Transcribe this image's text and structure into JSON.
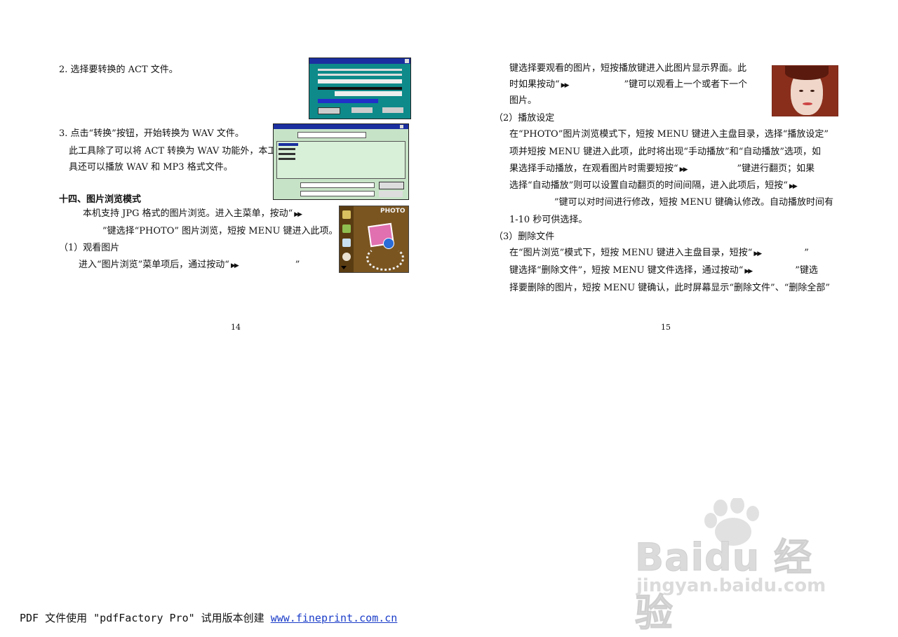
{
  "left_page": {
    "step2": "2. 选择要转换的 ACT 文件。",
    "step3_line1": "3. 点击“转换”按钮，开始转换为 WAV 文件。",
    "step3_line2": "此工具除了可以将 ACT 转换为 WAV 功能外，本工",
    "step3_line3": "具还可以播放 WAV 和 MP3 格式文件。",
    "section_heading": "十四、图片浏览模式",
    "intro_line1_a": "本机支持 JPG 格式的图片浏览。进入主菜单，按动“",
    "intro_line2": "”键选择“PHOTO” 图片浏览，短按 MENU 键进入此项。",
    "sub1_heading": "（1）观看图片",
    "sub1_line1_a": "进入“图片浏览”菜单项后，通过按动“",
    "sub1_line1_b": "”",
    "photo_label": "PHOTO",
    "page_number": "14"
  },
  "right_page": {
    "line1": "键选择要观看的图片，短按播放键进入此图片显示界面。此",
    "line2_a": "时如果按动“",
    "line2_b": "”键可以观看上一个或者下一个",
    "line3": "图片。",
    "sub2_heading": "（2）播放设定",
    "p2_l1": "在“PHOTO”图片浏览模式下，短按 MENU 键进入主盘目录，选择“播放设定”",
    "p2_l2": "项并短按 MENU 键进入此项，此时将出现“手动播放”和“自动播放”选项，如",
    "p2_l3_a": "果选择手动播放，在观看图片时需要短按“",
    "p2_l3_b": "”键进行翻页；如果",
    "p2_l4_a": "选择“自动播放”则可以设置自动翻页的时间间隔，进入此项后，短按“",
    "p2_l5": "”键可以对时间进行修改，短按 MENU 键确认修改。自动播放时间有",
    "p2_l6": "1-10 秒可供选择。",
    "sub3_heading": "（3）删除文件",
    "p3_l1_a": "在“图片浏览”模式下，短按 MENU 键进入主盘目录，短按“",
    "p3_l1_b": "”",
    "p3_l2_a": "键选择“删除文件”，短按 MENU 键文件选择，通过按动“",
    "p3_l2_b": "”键选",
    "p3_l3": "择要删除的图片，短按 MENU 键确认，此时屏幕显示“删除文件”、“删除全部”",
    "page_number": "15"
  },
  "ff_glyph": "▶▶",
  "footer": {
    "text": "PDF 文件使用 \"pdfFactory Pro\" 试用版本创建 ",
    "link": "www.fineprint.com.cn"
  },
  "watermark": {
    "brand": "Baidu 经验",
    "url": "jingyan.baidu.com"
  }
}
